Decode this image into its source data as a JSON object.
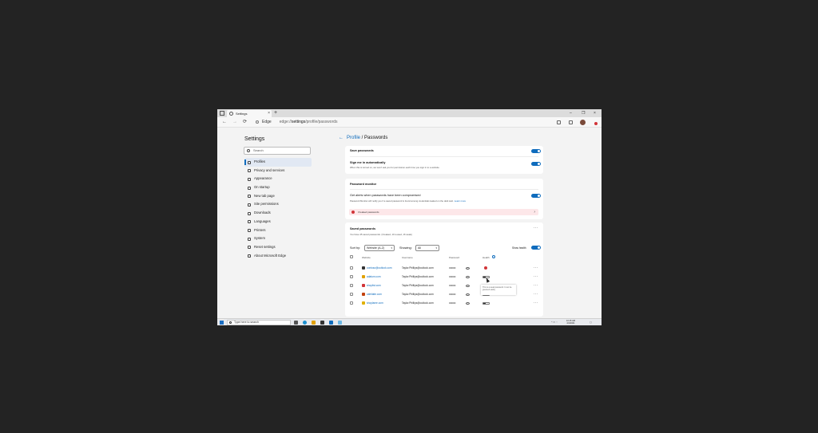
{
  "browser": {
    "tab_title": "Settings",
    "tab_close": "×",
    "new_tab": "+",
    "window_controls": [
      "–",
      "❐",
      "×"
    ],
    "nav": {
      "back": "←",
      "forward": "→",
      "refresh": "⟳"
    },
    "address": {
      "prefix": "Edge",
      "scheme": "edge://",
      "host": "settings",
      "path": "/profile/passwords"
    }
  },
  "sidebar": {
    "title": "Settings",
    "search_placeholder": "Search",
    "items": [
      {
        "label": "Profiles",
        "icon": "person-icon"
      },
      {
        "label": "Privacy and services",
        "icon": "lock-icon"
      },
      {
        "label": "Appearance",
        "icon": "appearance-icon"
      },
      {
        "label": "On startup",
        "icon": "power-icon"
      },
      {
        "label": "New tab page",
        "icon": "newtab-icon"
      },
      {
        "label": "Site permissions",
        "icon": "permissions-icon"
      },
      {
        "label": "Downloads",
        "icon": "download-icon"
      },
      {
        "label": "Languages",
        "icon": "language-icon"
      },
      {
        "label": "Printers",
        "icon": "printer-icon"
      },
      {
        "label": "System",
        "icon": "system-icon"
      },
      {
        "label": "Reset settings",
        "icon": "reset-icon"
      },
      {
        "label": "About Microsoft Edge",
        "icon": "edge-icon"
      }
    ]
  },
  "breadcrumb": {
    "back": "←",
    "parent": "Profile",
    "separator": " / ",
    "current": "Passwords"
  },
  "save_card": {
    "save_passwords": "Save passwords",
    "sign_in_title": "Sign me in automatically",
    "sign_in_desc": "When this is turned on, we won't ask you for permission each time you sign in to a website."
  },
  "monitor_card": {
    "title": "Password monitor",
    "alert_title": "Get alerts when passwords have been compromised",
    "alert_desc": "Password Monitor will notify you if a saved password is found among credentials leaked on the dark web.",
    "learn_more": "Learn more",
    "leaked": "3 leaked passwords",
    "leaked_chevron": "›"
  },
  "saved_card": {
    "title": "Saved passwords",
    "summary": "You have 45 saved passwords. (3 leaked, 10 reused, 16 weak)",
    "more": "···",
    "sort_label": "Sort by:",
    "sort_value": "Website (A-Z)",
    "showing_label": "Showing:",
    "showing_value": "All",
    "show_health": "Show health",
    "columns": {
      "website": "Website",
      "username": "Username",
      "password": "Password",
      "health": "Health"
    },
    "rows": [
      {
        "site": "contoso@outlook.com",
        "user": "Taylor.Phillips@outlook.com",
        "password": "••••••••••",
        "health": "leaked",
        "icon_color": "#333333"
      },
      {
        "site": "adatum.com",
        "user": "Taylor.Phillips@outlook.com",
        "password": "••••••••••",
        "health": "weak",
        "icon_color": "#e0a000"
      },
      {
        "site": "shoplist.com",
        "user": "Taylor.Phillips@outlook.com",
        "password": "••••••••••",
        "health": "weak",
        "icon_color": "#d13438"
      },
      {
        "site": "cafelatte.com",
        "user": "Taylor.Phillips@outlook.com",
        "password": "••••••••••",
        "health": "weak",
        "icon_color": "#c2410c"
      },
      {
        "site": "shoplame.com",
        "user": "Taylor.Phillips@outlook.com",
        "password": "••••••••••",
        "health": "weak",
        "icon_color": "#e0b000"
      }
    ],
    "tooltip": "This is a weak password. It can be guessed easily.",
    "row_more": "···"
  },
  "taskbar": {
    "search_placeholder": "Type here to search",
    "time": "10:15 AM",
    "date": "4/1/2021"
  },
  "colors": {
    "accent": "#0f6cbd",
    "danger": "#d13438",
    "leak_bg": "#fde7e9"
  }
}
